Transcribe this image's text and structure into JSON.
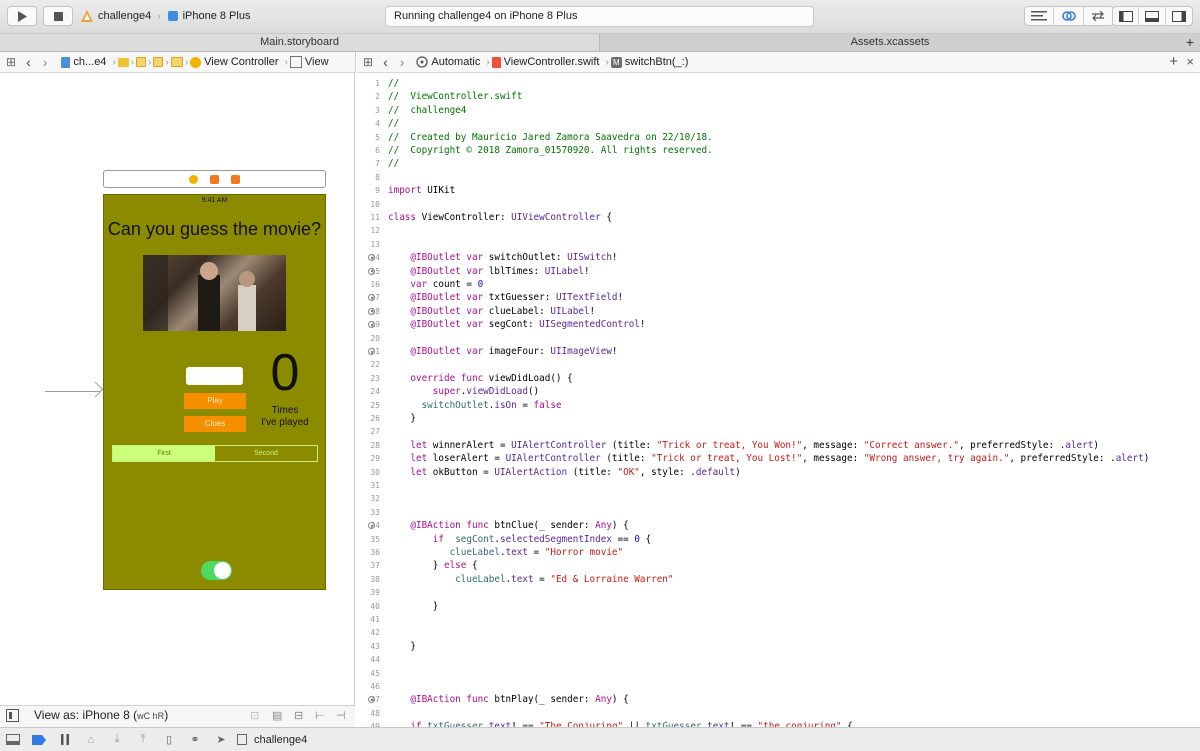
{
  "toolbar": {
    "scheme_name": "challenge4",
    "device_name": "iPhone 8 Plus",
    "status_text": "Running challenge4 on iPhone 8 Plus"
  },
  "tabs": [
    {
      "label": "Main.storyboard"
    },
    {
      "label": "Assets.xcassets"
    }
  ],
  "left_jump": {
    "project": "ch...e4",
    "scene": "View Controller",
    "view": "View"
  },
  "right_jump": {
    "mode": "Automatic",
    "file": "ViewController.swift",
    "method_badge": "M",
    "method": "switchBtn(_:)"
  },
  "phone": {
    "time": "9:41 AM",
    "title": "Can you guess the movie?",
    "count": "0",
    "times_line1": "Times",
    "times_line2": "I've played",
    "play_label": "Play",
    "clues_label": "Clues",
    "segments": [
      "First",
      "Second"
    ],
    "switch_on": true,
    "colors": {
      "background": "#8c8b00",
      "button": "#f58f00",
      "segment_selected": "#ccff7a",
      "switch": "#4cd964"
    }
  },
  "storyboard_footer": {
    "view_as": "View as: iPhone 8 (",
    "size_class": "wC hR",
    "close": ")"
  },
  "code_lines": [
    {
      "n": "1",
      "bp": false,
      "tokens": [
        {
          "t": "//",
          "c": "c"
        }
      ]
    },
    {
      "n": "2",
      "bp": false,
      "tokens": [
        {
          "t": "//  ViewController.swift",
          "c": "c"
        }
      ]
    },
    {
      "n": "3",
      "bp": false,
      "tokens": [
        {
          "t": "//  challenge4",
          "c": "c"
        }
      ]
    },
    {
      "n": "4",
      "bp": false,
      "tokens": [
        {
          "t": "//",
          "c": "c"
        }
      ]
    },
    {
      "n": "5",
      "bp": false,
      "tokens": [
        {
          "t": "//  Created by Mauricio Jared Zamora Saavedra on 22/10/18.",
          "c": "c"
        }
      ]
    },
    {
      "n": "6",
      "bp": false,
      "tokens": [
        {
          "t": "//  Copyright © 2018 Zamora_01570920. All rights reserved.",
          "c": "c"
        }
      ]
    },
    {
      "n": "7",
      "bp": false,
      "tokens": [
        {
          "t": "//",
          "c": "c"
        }
      ]
    },
    {
      "n": "8",
      "bp": false,
      "tokens": []
    },
    {
      "n": "9",
      "bp": false,
      "tokens": [
        {
          "t": "import",
          "c": "k"
        },
        {
          "t": " UIKit",
          "c": "p"
        }
      ]
    },
    {
      "n": "10",
      "bp": false,
      "tokens": []
    },
    {
      "n": "11",
      "bp": false,
      "tokens": [
        {
          "t": "class",
          "c": "k"
        },
        {
          "t": " ViewController: ",
          "c": "p"
        },
        {
          "t": "UIViewController",
          "c": "t"
        },
        {
          "t": " {",
          "c": "p"
        }
      ]
    },
    {
      "n": "12",
      "bp": false,
      "tokens": []
    },
    {
      "n": "13",
      "bp": false,
      "tokens": []
    },
    {
      "n": "14",
      "bp": true,
      "tokens": [
        {
          "t": "    @IBOutlet",
          "c": "k"
        },
        {
          "t": " ",
          "c": "p"
        },
        {
          "t": "var",
          "c": "k"
        },
        {
          "t": " switchOutlet: ",
          "c": "p"
        },
        {
          "t": "UISwitch",
          "c": "t"
        },
        {
          "t": "!",
          "c": "p"
        }
      ]
    },
    {
      "n": "15",
      "bp": true,
      "tokens": [
        {
          "t": "    @IBOutlet",
          "c": "k"
        },
        {
          "t": " ",
          "c": "p"
        },
        {
          "t": "var",
          "c": "k"
        },
        {
          "t": " lblTimes: ",
          "c": "p"
        },
        {
          "t": "UILabel",
          "c": "t"
        },
        {
          "t": "!",
          "c": "p"
        }
      ]
    },
    {
      "n": "16",
      "bp": false,
      "tokens": [
        {
          "t": "    var",
          "c": "k"
        },
        {
          "t": " count = ",
          "c": "p"
        },
        {
          "t": "0",
          "c": "n"
        }
      ]
    },
    {
      "n": "17",
      "bp": true,
      "tokens": [
        {
          "t": "    @IBOutlet",
          "c": "k"
        },
        {
          "t": " ",
          "c": "p"
        },
        {
          "t": "var",
          "c": "k"
        },
        {
          "t": " txtGuesser: ",
          "c": "p"
        },
        {
          "t": "UITextField",
          "c": "t"
        },
        {
          "t": "!",
          "c": "p"
        }
      ]
    },
    {
      "n": "18",
      "bp": true,
      "tokens": [
        {
          "t": "    @IBOutlet",
          "c": "k"
        },
        {
          "t": " ",
          "c": "p"
        },
        {
          "t": "var",
          "c": "k"
        },
        {
          "t": " clueLabel: ",
          "c": "p"
        },
        {
          "t": "UILabel",
          "c": "t"
        },
        {
          "t": "!",
          "c": "p"
        }
      ]
    },
    {
      "n": "19",
      "bp": true,
      "tokens": [
        {
          "t": "    @IBOutlet",
          "c": "k"
        },
        {
          "t": " ",
          "c": "p"
        },
        {
          "t": "var",
          "c": "k"
        },
        {
          "t": " segCont: ",
          "c": "p"
        },
        {
          "t": "UISegmentedControl",
          "c": "t"
        },
        {
          "t": "!",
          "c": "p"
        }
      ]
    },
    {
      "n": "20",
      "bp": false,
      "tokens": []
    },
    {
      "n": "21",
      "bp": true,
      "tokens": [
        {
          "t": "    @IBOutlet",
          "c": "k"
        },
        {
          "t": " ",
          "c": "p"
        },
        {
          "t": "var",
          "c": "k"
        },
        {
          "t": " imageFour: ",
          "c": "p"
        },
        {
          "t": "UIImageView",
          "c": "t"
        },
        {
          "t": "!",
          "c": "p"
        }
      ]
    },
    {
      "n": "22",
      "bp": false,
      "tokens": []
    },
    {
      "n": "23",
      "bp": false,
      "tokens": [
        {
          "t": "    override",
          "c": "k"
        },
        {
          "t": " ",
          "c": "p"
        },
        {
          "t": "func",
          "c": "k"
        },
        {
          "t": " viewDidLoad() {",
          "c": "p"
        }
      ]
    },
    {
      "n": "24",
      "bp": false,
      "tokens": [
        {
          "t": "        super",
          "c": "k"
        },
        {
          "t": ".",
          "c": "p"
        },
        {
          "t": "viewDidLoad",
          "c": "t"
        },
        {
          "t": "()",
          "c": "p"
        }
      ]
    },
    {
      "n": "25",
      "bp": false,
      "tokens": [
        {
          "t": "      switchOutlet",
          "c": "f"
        },
        {
          "t": ".",
          "c": "p"
        },
        {
          "t": "isOn",
          "c": "t"
        },
        {
          "t": " = ",
          "c": "p"
        },
        {
          "t": "false",
          "c": "k"
        }
      ]
    },
    {
      "n": "26",
      "bp": false,
      "tokens": [
        {
          "t": "    }",
          "c": "p"
        }
      ]
    },
    {
      "n": "27",
      "bp": false,
      "tokens": []
    },
    {
      "n": "28",
      "bp": false,
      "tokens": [
        {
          "t": "    let",
          "c": "k"
        },
        {
          "t": " winnerAlert = ",
          "c": "p"
        },
        {
          "t": "UIAlertController",
          "c": "t"
        },
        {
          "t": " (title: ",
          "c": "p"
        },
        {
          "t": "\"Trick or treat, You Won!\"",
          "c": "s"
        },
        {
          "t": ", message: ",
          "c": "p"
        },
        {
          "t": "\"Correct answer.\"",
          "c": "s"
        },
        {
          "t": ", preferredStyle: .",
          "c": "p"
        },
        {
          "t": "alert",
          "c": "t"
        },
        {
          "t": ")",
          "c": "p"
        }
      ]
    },
    {
      "n": "29",
      "bp": false,
      "tokens": [
        {
          "t": "    let",
          "c": "k"
        },
        {
          "t": " loserAlert = ",
          "c": "p"
        },
        {
          "t": "UIAlertController",
          "c": "t"
        },
        {
          "t": " (title: ",
          "c": "p"
        },
        {
          "t": "\"Trick or treat, You Lost!\"",
          "c": "s"
        },
        {
          "t": ", message: ",
          "c": "p"
        },
        {
          "t": "\"Wrong answer, try again.\"",
          "c": "s"
        },
        {
          "t": ", preferredStyle: .",
          "c": "p"
        },
        {
          "t": "alert",
          "c": "t"
        },
        {
          "t": ")",
          "c": "p"
        }
      ]
    },
    {
      "n": "30",
      "bp": false,
      "tokens": [
        {
          "t": "    let",
          "c": "k"
        },
        {
          "t": " okButton = ",
          "c": "p"
        },
        {
          "t": "UIAlertAction",
          "c": "t"
        },
        {
          "t": " (title: ",
          "c": "p"
        },
        {
          "t": "\"OK\"",
          "c": "s"
        },
        {
          "t": ", style: .",
          "c": "p"
        },
        {
          "t": "default",
          "c": "t"
        },
        {
          "t": ")",
          "c": "p"
        }
      ]
    },
    {
      "n": "31",
      "bp": false,
      "tokens": []
    },
    {
      "n": "32",
      "bp": false,
      "tokens": []
    },
    {
      "n": "33",
      "bp": false,
      "tokens": []
    },
    {
      "n": "34",
      "bp": true,
      "tokens": [
        {
          "t": "    @IBAction",
          "c": "k"
        },
        {
          "t": " ",
          "c": "p"
        },
        {
          "t": "func",
          "c": "k"
        },
        {
          "t": " btnClue(_ sender: ",
          "c": "p"
        },
        {
          "t": "Any",
          "c": "k"
        },
        {
          "t": ") {",
          "c": "p"
        }
      ]
    },
    {
      "n": "35",
      "bp": false,
      "tokens": [
        {
          "t": "        if",
          "c": "k"
        },
        {
          "t": "  ",
          "c": "p"
        },
        {
          "t": "segCont",
          "c": "f"
        },
        {
          "t": ".",
          "c": "p"
        },
        {
          "t": "selectedSegmentIndex",
          "c": "t"
        },
        {
          "t": " == ",
          "c": "p"
        },
        {
          "t": "0",
          "c": "n"
        },
        {
          "t": " {",
          "c": "p"
        }
      ]
    },
    {
      "n": "36",
      "bp": false,
      "tokens": [
        {
          "t": "           clueLabel",
          "c": "f"
        },
        {
          "t": ".",
          "c": "p"
        },
        {
          "t": "text",
          "c": "t"
        },
        {
          "t": " = ",
          "c": "p"
        },
        {
          "t": "\"Horror movie\"",
          "c": "s"
        }
      ]
    },
    {
      "n": "37",
      "bp": false,
      "tokens": [
        {
          "t": "        } ",
          "c": "p"
        },
        {
          "t": "else",
          "c": "k"
        },
        {
          "t": " {",
          "c": "p"
        }
      ]
    },
    {
      "n": "38",
      "bp": false,
      "tokens": [
        {
          "t": "            clueLabel",
          "c": "f"
        },
        {
          "t": ".",
          "c": "p"
        },
        {
          "t": "text",
          "c": "t"
        },
        {
          "t": " = ",
          "c": "p"
        },
        {
          "t": "\"Ed & Lorraine Warren\"",
          "c": "s"
        }
      ]
    },
    {
      "n": "39",
      "bp": false,
      "tokens": []
    },
    {
      "n": "40",
      "bp": false,
      "tokens": [
        {
          "t": "        }",
          "c": "p"
        }
      ]
    },
    {
      "n": "41",
      "bp": false,
      "tokens": []
    },
    {
      "n": "42",
      "bp": false,
      "tokens": []
    },
    {
      "n": "43",
      "bp": false,
      "tokens": [
        {
          "t": "    }",
          "c": "p"
        }
      ]
    },
    {
      "n": "44",
      "bp": false,
      "tokens": []
    },
    {
      "n": "45",
      "bp": false,
      "tokens": []
    },
    {
      "n": "46",
      "bp": false,
      "tokens": []
    },
    {
      "n": "47",
      "bp": true,
      "tokens": [
        {
          "t": "    @IBAction",
          "c": "k"
        },
        {
          "t": " ",
          "c": "p"
        },
        {
          "t": "func",
          "c": "k"
        },
        {
          "t": " btnPlay(_ sender: ",
          "c": "p"
        },
        {
          "t": "Any",
          "c": "k"
        },
        {
          "t": ") {",
          "c": "p"
        }
      ]
    },
    {
      "n": "48",
      "bp": false,
      "tokens": []
    },
    {
      "n": "49",
      "bp": false,
      "tokens": [
        {
          "t": "    if",
          "c": "k"
        },
        {
          "t": " ",
          "c": "p"
        },
        {
          "t": "txtGuesser",
          "c": "f"
        },
        {
          "t": ".",
          "c": "p"
        },
        {
          "t": "text",
          "c": "t"
        },
        {
          "t": "! == ",
          "c": "p"
        },
        {
          "t": "\"The Conjuring\"",
          "c": "s"
        },
        {
          "t": " || ",
          "c": "p"
        },
        {
          "t": "txtGuesser",
          "c": "f"
        },
        {
          "t": ".",
          "c": "p"
        },
        {
          "t": "text",
          "c": "t"
        },
        {
          "t": "! == ",
          "c": "p"
        },
        {
          "t": "\"the conjuring\"",
          "c": "s"
        },
        {
          "t": " {",
          "c": "p"
        }
      ]
    }
  ],
  "debug_bar": {
    "target": "challenge4"
  }
}
